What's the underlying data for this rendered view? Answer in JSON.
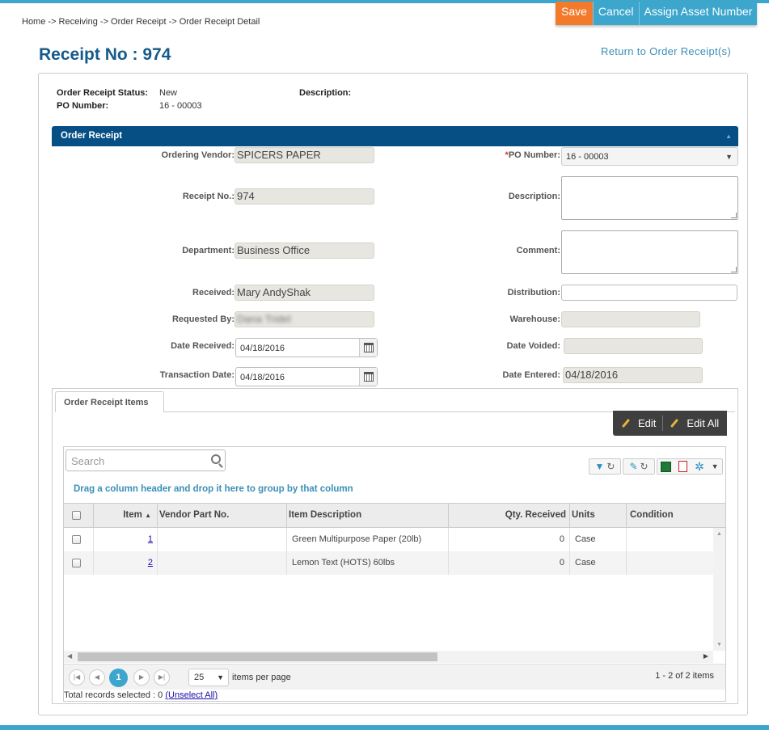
{
  "breadcrumb": "Home -> Receiving -> Order Receipt -> Order Receipt Detail",
  "actions": {
    "save": "Save",
    "cancel": "Cancel",
    "assign": "Assign Asset Number"
  },
  "page": {
    "title": "Receipt No : 974",
    "return_link": "Return to Order Receipt(s)"
  },
  "summary": {
    "status_label": "Order Receipt Status:",
    "status_value": "New",
    "po_label": "PO Number:",
    "po_value": "16 - 00003",
    "description_label": "Description:"
  },
  "section": {
    "title": "Order Receipt"
  },
  "form": {
    "vendor_label": "Ordering Vendor",
    "vendor_value": "SPICERS PAPER",
    "receipt_label": "Receipt No.",
    "receipt_value": "974",
    "department_label": "Department",
    "department_value": "Business Office",
    "received_label": "Received",
    "received_value": "Mary AndyShak",
    "requested_label": "Requested By",
    "requested_value": "Dana Tridel",
    "date_received_label": "Date Received",
    "date_received_value": "04/18/2016",
    "transaction_label": "Transaction Date",
    "transaction_value": "04/18/2016",
    "po_req": "*",
    "po_label": "PO Number",
    "po_value": "16 - 00003",
    "description_label": "Description",
    "comment_label": "Comment",
    "distribution_label": "Distribution",
    "warehouse_label": "Warehouse",
    "date_voided_label": "Date Voided",
    "date_entered_label": "Date Entered",
    "date_entered_value": "04/18/2016"
  },
  "items": {
    "tab_label": "Order Receipt Items",
    "edit": "Edit",
    "edit_all": "Edit All",
    "search_placeholder": "Search",
    "group_hint": "Drag a column header and drop it here to group by that column",
    "columns": {
      "item": "Item",
      "sort": "▲",
      "vendor_part": "Vendor Part No.",
      "description": "Item Description",
      "qty": "Qty. Received",
      "units": "Units",
      "condition": "Condition"
    },
    "rows": [
      {
        "item": "1",
        "vendor_part": "",
        "description": "Green Multipurpose Paper (20lb)",
        "qty": "0",
        "units": "Case",
        "condition": ""
      },
      {
        "item": "2",
        "vendor_part": "",
        "description": "Lemon Text (HOTS) 60lbs",
        "qty": "0",
        "units": "Case",
        "condition": ""
      }
    ],
    "pager": {
      "page": "1",
      "page_size": "25",
      "items_per_page": "items per page",
      "count": "1 - 2 of 2 items"
    },
    "selected_text": "Total records selected : 0",
    "unselect": "(Unselect All)"
  },
  "icons": [
    "filter-icon",
    "refresh-icon",
    "wrench-icon",
    "excel-icon",
    "pdf-icon",
    "gear-icon",
    "calendar-icon",
    "search-icon",
    "pencil-icon"
  ],
  "colors": {
    "accent": "#3ca6cc",
    "save": "#f37a2b",
    "header": "#054f84",
    "title": "#165a8b"
  }
}
